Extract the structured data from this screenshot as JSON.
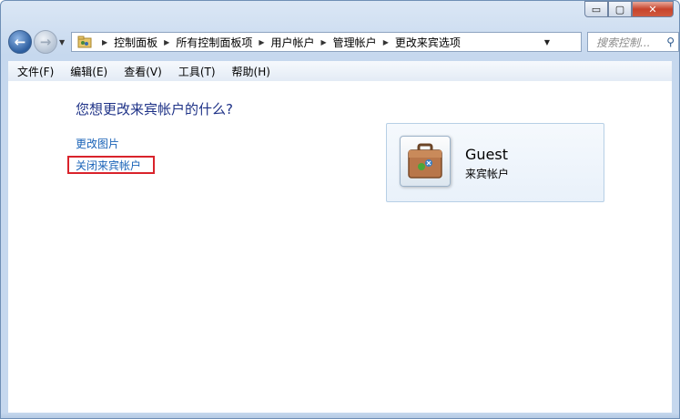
{
  "window": {
    "caption_minimize": "▭",
    "caption_maximize": "▢",
    "caption_close": "✕"
  },
  "address_bar": {
    "breadcrumbs": [
      "控制面板",
      "所有控制面板项",
      "用户帐户",
      "管理帐户",
      "更改来宾选项"
    ]
  },
  "search": {
    "placeholder": "搜索控制..."
  },
  "menu": [
    "文件(F)",
    "编辑(E)",
    "查看(V)",
    "工具(T)",
    "帮助(H)"
  ],
  "main": {
    "heading": "您想更改来宾帐户的什么?",
    "links": [
      "更改图片",
      "关闭来宾帐户"
    ]
  },
  "account": {
    "name": "Guest",
    "type": "来宾帐户"
  },
  "colors": {
    "heading": "#1e3287",
    "link": "#1a63b8",
    "highlight_box": "#d9232b"
  }
}
